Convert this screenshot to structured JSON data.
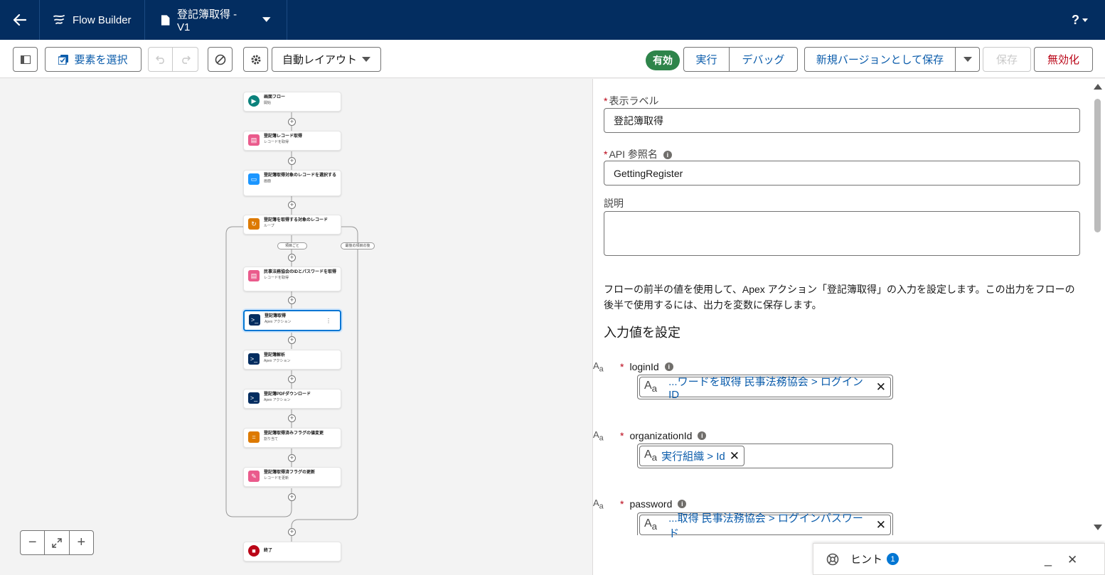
{
  "topbar": {
    "brand": "Flow Builder",
    "flow_name": "登記簿取得 - V1",
    "help": "?"
  },
  "toolbar": {
    "select_elements": "要素を選択",
    "auto_layout": "自動レイアウト",
    "status": "有効",
    "run": "実行",
    "debug": "デバッグ",
    "save_as_new": "新規バージョンとして保存",
    "save": "保存",
    "deactivate": "無効化"
  },
  "canvas": {
    "nodes": [
      {
        "title": "画面フロー",
        "subtitle": "開始",
        "color": "#0b827c"
      },
      {
        "title": "登記簿レコード取得",
        "subtitle": "レコードを取得",
        "color": "#ea5b8c"
      },
      {
        "title": "登記簿取得対象のレコードを選択する",
        "subtitle": "画面",
        "color": "#1b96ff"
      },
      {
        "title": "登記簿を取得する対象のレコード",
        "subtitle": "ループ",
        "color": "#dd7a01"
      },
      {
        "title": "民事法務協会のIDとパスワードを取得",
        "subtitle": "レコードを取得",
        "color": "#ea5b8c"
      },
      {
        "title": "登記簿取得",
        "subtitle": "Apex アクション",
        "color": "#032d60"
      },
      {
        "title": "登記簿解析",
        "subtitle": "Apex アクション",
        "color": "#032d60"
      },
      {
        "title": "登記簿PDFダウンロード",
        "subtitle": "Apex アクション",
        "color": "#032d60"
      },
      {
        "title": "登記簿取得済みフラグの値変更",
        "subtitle": "割り当て",
        "color": "#dd7a01"
      },
      {
        "title": "登記簿取得済フラグの更新",
        "subtitle": "レコードを更新",
        "color": "#ea5b8c"
      },
      {
        "title": "終了",
        "subtitle": "",
        "color": "#ba0517"
      }
    ],
    "loop_for_each": "項目ごと",
    "loop_after_last": "最後の項目の後"
  },
  "panel": {
    "label_label": "表示ラベル",
    "label_value": "登記簿取得",
    "api_label": "API 参照名",
    "api_value": "GettingRegister",
    "description_label": "説明",
    "description_value": "",
    "help_text": "フローの前半の値を使用して、Apex アクション「登記簿取得」の入力を設定します。この出力をフローの後半で使用するには、出力を変数に保存します。",
    "section_title": "入力値を設定",
    "params": [
      {
        "name": "loginId",
        "value": "...ワードを取得 民事法務協会 > ログインID"
      },
      {
        "name": "organizationId",
        "value": "実行組織 > Id"
      },
      {
        "name": "password",
        "value": "...取得 民事法務協会 > ログインパスワード"
      }
    ]
  },
  "hint": {
    "label": "ヒント",
    "count": "1"
  }
}
